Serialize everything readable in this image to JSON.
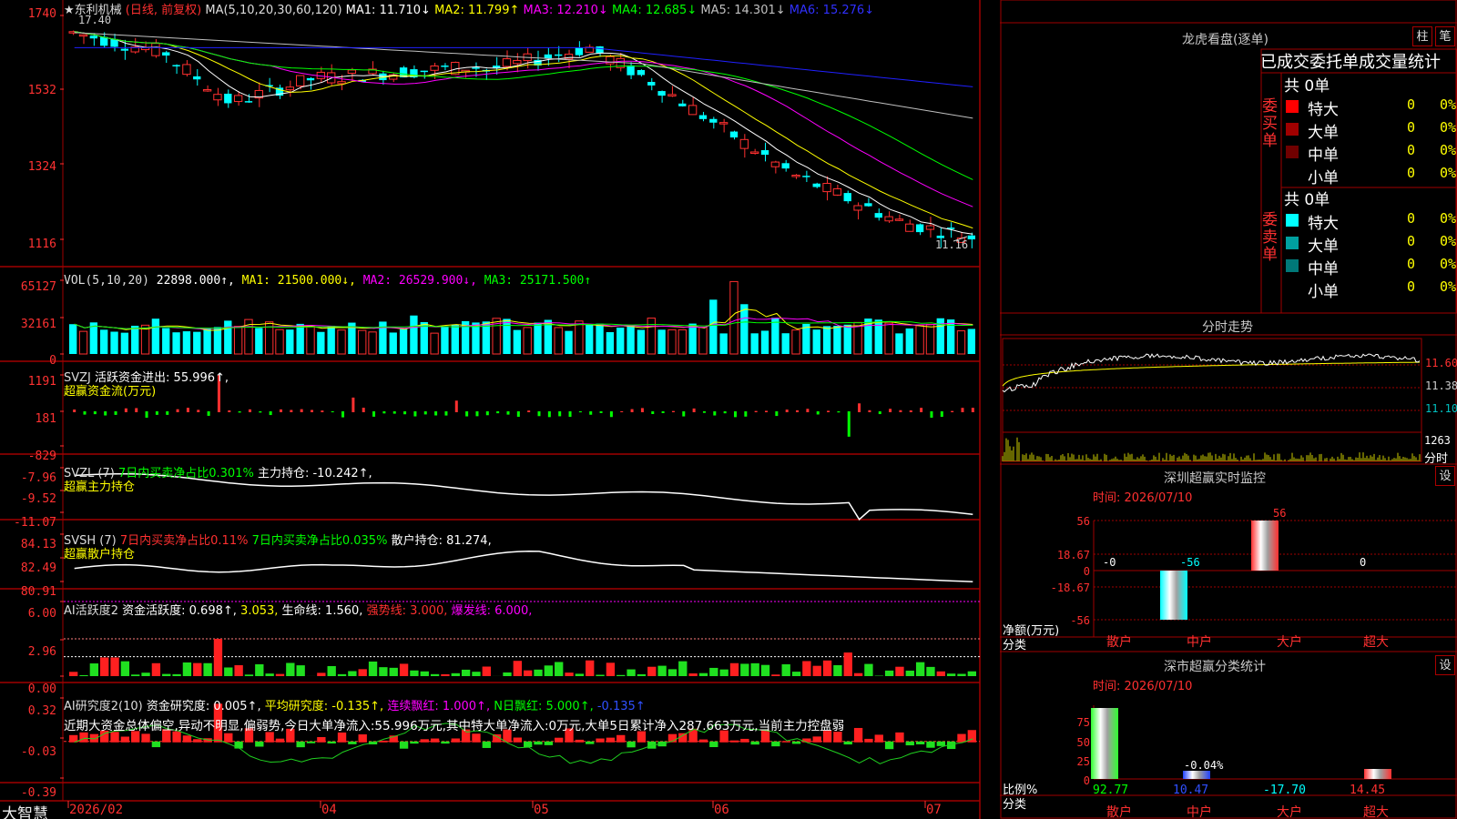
{
  "stock": {
    "name": "★东利机械",
    "mode": "(日线, 前复权)",
    "ma_label": "MA(5,10,20,30,60,120)",
    "ma": [
      {
        "label": "MA1: 11.710↓",
        "color": "#ffffff"
      },
      {
        "label": "MA2: 11.799↑",
        "color": "#ffff00"
      },
      {
        "label": "MA3: 12.210↓",
        "color": "#ff00ff"
      },
      {
        "label": "MA4: 12.685↓",
        "color": "#00ff00"
      },
      {
        "label": "MA5: 14.301↓",
        "color": "#c0c0c0"
      },
      {
        "label": "MA6: 15.276↓",
        "color": "#0000ff"
      }
    ],
    "high_label": "17.40",
    "low_label": "11.16"
  },
  "price_axis": [
    "1740",
    "1532",
    "1324",
    "1116"
  ],
  "vol": {
    "label": "VOL(5,10,20)",
    "value": "22898.000↑,",
    "ma1": "MA1: 21500.000↓,",
    "ma2": "MA2: 26529.900↓,",
    "ma3": "MA3: 25171.500↑",
    "axis": [
      "65127",
      "32161",
      "0"
    ]
  },
  "svzj": {
    "title": "SVZJ",
    "text": "活跃资金进出: 55.996↑,",
    "sub": "超赢资金流(万元)",
    "axis": [
      "1191",
      "181",
      "-829"
    ]
  },
  "svzl": {
    "title": "SVZL (7)",
    "t1": "7日内买卖净占比0.301%",
    "t2": "主力持仓: -10.242↑,",
    "sub": "超赢主力持仓",
    "axis": [
      "-7.96",
      "-9.52",
      "-11.07"
    ]
  },
  "svsh": {
    "title": "SVSH (7)",
    "t1": "7日内买卖净占比0.11%",
    "t2": "7日内买卖净占比0.035%",
    "t3": "散户持仓: 81.274,",
    "sub": "超赢散户持仓",
    "axis": [
      "84.13",
      "82.49",
      "80.91"
    ]
  },
  "ai1": {
    "title": "AI活跃度2",
    "t1": "资金活跃度: 0.698↑,",
    "t2": "3.053,",
    "t3": "生命线: 1.560,",
    "t4": "强势线: 3.000,",
    "t5": "爆发线: 6.000,",
    "axis": [
      "6.00",
      "2.96",
      "0.00"
    ]
  },
  "ai2": {
    "title": "AI研究度2(10)",
    "t1": "资金研究度: 0.005↑,",
    "t2": "平均研究度: -0.135↑,",
    "t3": "连续飘红: 1.000↑,",
    "t4": "N日飘红: 5.000↑,",
    "t5": "-0.135↑",
    "summary": "近期大资金总体偏空,异动不明显,偏弱势,今日大单净流入:55.996万元,其中特大单净流入:0万元,大单5日累计净入287.663万元,当前主力控盘弱",
    "axis": [
      "0.32",
      "-0.03",
      "-0.39"
    ]
  },
  "date_axis": [
    "2026/02",
    "04",
    "05",
    "06",
    "07"
  ],
  "logo": "大智慧",
  "longhu": {
    "title": "龙虎看盘(逐单)",
    "btn1": "柱",
    "btn2": "笔",
    "tabs": "已成交委托单成交量统计",
    "buy": {
      "side_label": "委买单",
      "total": "共 0单",
      "rows": [
        {
          "name": "特大",
          "val": "0",
          "pct": "0%",
          "color": "#ff0000"
        },
        {
          "name": "大单",
          "val": "0",
          "pct": "0%",
          "color": "#a00000"
        },
        {
          "name": "中单",
          "val": "0",
          "pct": "0%",
          "color": "#700000"
        },
        {
          "name": "小单",
          "val": "0",
          "pct": "0%",
          "color": "#000000"
        }
      ]
    },
    "sell": {
      "side_label": "委卖单",
      "total": "共 0单",
      "rows": [
        {
          "name": "特大",
          "val": "0",
          "pct": "0%",
          "color": "#00ffff"
        },
        {
          "name": "大单",
          "val": "0",
          "pct": "0%",
          "color": "#00a0a0"
        },
        {
          "name": "中单",
          "val": "0",
          "pct": "0%",
          "color": "#007878"
        },
        {
          "name": "小单",
          "val": "0",
          "pct": "0%",
          "color": "#000000"
        }
      ]
    }
  },
  "intraday": {
    "title": "分时走势",
    "axis": [
      "11.60",
      "11.38",
      "11.10"
    ],
    "vol_axis": "1263",
    "unit": "分时"
  },
  "monitor": {
    "title": "深圳超赢实时监控",
    "btn": "设",
    "time": "时间: 2026/07/10",
    "axis": [
      "56",
      "18.67",
      "0",
      "-18.67",
      "-56"
    ],
    "net_label": "净额(万元)",
    "cat_label": "分类",
    "categories": [
      "散户",
      "中户",
      "大户",
      "超大"
    ],
    "values": [
      "-0",
      "-56",
      "56",
      "0"
    ]
  },
  "classify": {
    "title": "深市超赢分类统计",
    "btn": "设",
    "time": "时间: 2026/07/10",
    "axis": [
      "75",
      "50",
      "25",
      "0"
    ],
    "ratio_label": "比例%",
    "cat_label": "分类",
    "categories": [
      "散户",
      "中户",
      "大户",
      "超大"
    ],
    "values": [
      "92.77",
      "10.47",
      "-17.70",
      "14.45"
    ],
    "annot": "-0.04%"
  }
}
